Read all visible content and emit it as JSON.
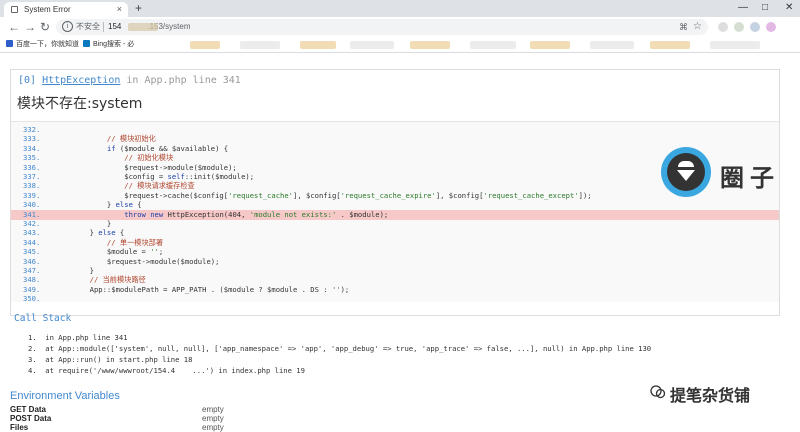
{
  "browser": {
    "tab_title": "System Error",
    "tab_close": "×",
    "new_tab": "+",
    "window_controls": [
      "—",
      "□",
      "✕"
    ],
    "security_label": "不安全",
    "url_host": "154",
    "url_path": ".153/system",
    "info_glyph": "i"
  },
  "bookmarks": [
    {
      "label": "百度一下，你就知道",
      "color": "#2d5ec9"
    },
    {
      "label": "Bing搜索 - 必",
      "color": "#0a7ac0"
    }
  ],
  "exception": {
    "index": "[0]",
    "class": "HttpException",
    "in_text": "in",
    "file": "App.php line 341",
    "message": "模块不存在:system"
  },
  "source_lines": [
    {
      "n": "332.",
      "code": ""
    },
    {
      "n": "333.",
      "code": "            // 模块初始化"
    },
    {
      "n": "334.",
      "code": "            if ($module && $available) {"
    },
    {
      "n": "335.",
      "code": "                // 初始化模块"
    },
    {
      "n": "336.",
      "code": "                $request->module($module);"
    },
    {
      "n": "337.",
      "code": "                $config = self::init($module);"
    },
    {
      "n": "338.",
      "code": "                // 模块请求缓存检查"
    },
    {
      "n": "339.",
      "code": "                $request->cache($config['request_cache'], $config['request_cache_expire'], $config['request_cache_except']);"
    },
    {
      "n": "340.",
      "code": "            } else {"
    },
    {
      "n": "341.",
      "code": "                throw new HttpException(404, 'module not exists:' . $module);"
    },
    {
      "n": "342.",
      "code": "            }"
    },
    {
      "n": "343.",
      "code": "        } else {"
    },
    {
      "n": "344.",
      "code": "            // 单一模块部署"
    },
    {
      "n": "345.",
      "code": "            $module = '';"
    },
    {
      "n": "346.",
      "code": "            $request->module($module);"
    },
    {
      "n": "347.",
      "code": "        }"
    },
    {
      "n": "348.",
      "code": "        // 当前模块路径"
    },
    {
      "n": "349.",
      "code": "        App::$modulePath = APP_PATH . ($module ? $module . DS : '');"
    },
    {
      "n": "350.",
      "code": ""
    }
  ],
  "highlight_line": "341.",
  "call_stack": {
    "title": "Call Stack",
    "items": [
      "1.  in App.php line 341",
      "2.  at App::module(['system', null, null], ['app_namespace' => 'app', 'app_debug' => true, 'app_trace' => false, ...], null) in App.php line 130",
      "3.  at App::run() in start.php line 18",
      "4.  at require('/www/wwwroot/154.4    ...') in index.php line 19"
    ]
  },
  "env": {
    "title": "Environment Variables",
    "rows": [
      {
        "key": "GET Data",
        "value": "empty"
      },
      {
        "key": "POST Data",
        "value": "empty"
      },
      {
        "key": "Files",
        "value": "empty"
      }
    ]
  },
  "overlay": {
    "badge_text": "圈子",
    "watermark": "提笔杂货铺"
  },
  "colors": {
    "link_blue": "#4288ce",
    "highlight_row": "#f6c8c8",
    "badge_ring": "#3aa7e0"
  }
}
